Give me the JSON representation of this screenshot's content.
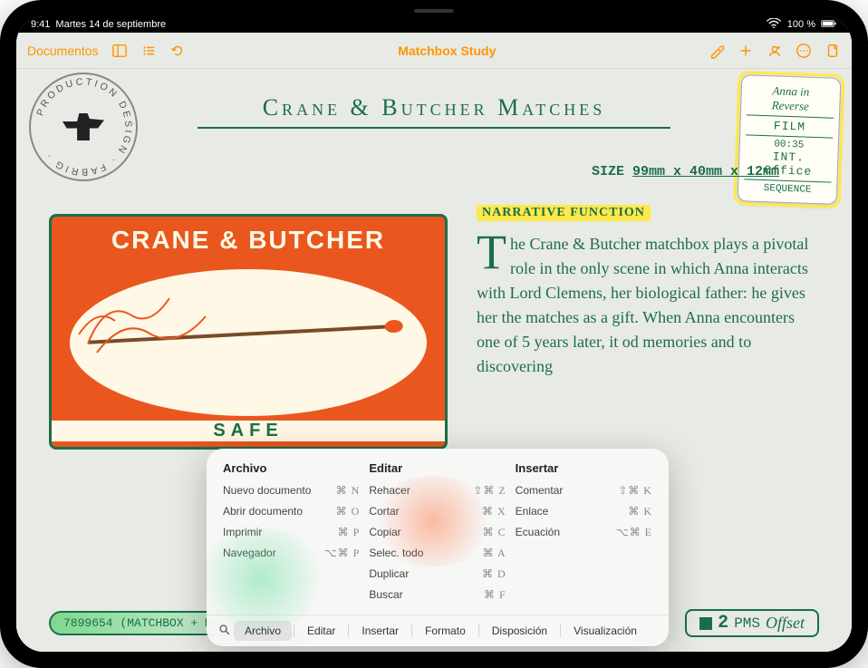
{
  "status": {
    "time": "9:41",
    "date": "Martes 14 de septiembre",
    "battery": "100 %",
    "wifi": "wifi-icon"
  },
  "toolbar": {
    "back_label": "Documentos",
    "title": "Matchbox Study"
  },
  "doc": {
    "heading": "Crane & Butcher Matches",
    "size_label": "SIZE",
    "size_value": "99mm x 40mm x 12mm",
    "narrative_label": "NARRATIVE FUNCTION",
    "body_dropcap": "T",
    "body_text": "he Crane & Butcher matchbox plays a pivotal role in the only scene in which Anna interacts with Lord Clemens, her biological father: he gives her the matches as a gift. When Anna encounters one of                                  5 years later, it                                  od memories and                                  to discovering",
    "matchbox_top": "CRANE & BUTCHER",
    "matchbox_bottom": "SAFE",
    "ticket_text": "7899654 (MATCHBOX + MATCH STICKS)",
    "pms_num": "2",
    "pms_label": "PMS",
    "pms_offset": "Offset"
  },
  "sticker": {
    "line1": "Anna in",
    "line2": "Reverse",
    "line3": "FILM",
    "time": "00:35",
    "loc": "INT. Office",
    "seq": "SEQUENCE"
  },
  "overlay": {
    "columns": [
      {
        "title": "Archivo",
        "items": [
          {
            "label": "Nuevo documento",
            "shortcut": "⌘ N"
          },
          {
            "label": "Abrir documento",
            "shortcut": "⌘ O"
          },
          {
            "label": "Imprimir",
            "shortcut": "⌘ P"
          },
          {
            "label": "Navegador",
            "shortcut": "⌥⌘ P"
          }
        ]
      },
      {
        "title": "Editar",
        "items": [
          {
            "label": "Rehacer",
            "shortcut": "⇧⌘ Z"
          },
          {
            "label": "Cortar",
            "shortcut": "⌘ X"
          },
          {
            "label": "Copiar",
            "shortcut": "⌘ C"
          },
          {
            "label": "Selec. todo",
            "shortcut": "⌘ A"
          },
          {
            "label": "Duplicar",
            "shortcut": "⌘ D"
          },
          {
            "label": "Buscar",
            "shortcut": "⌘ F"
          }
        ]
      },
      {
        "title": "Insertar",
        "items": [
          {
            "label": "Comentar",
            "shortcut": "⇧⌘ K"
          },
          {
            "label": "Enlace",
            "shortcut": "⌘ K"
          },
          {
            "label": "Ecuación",
            "shortcut": "⌥⌘ E"
          }
        ]
      }
    ],
    "tabs": [
      "Archivo",
      "Editar",
      "Insertar",
      "Formato",
      "Disposición",
      "Visualización"
    ],
    "active_tab": 0
  }
}
